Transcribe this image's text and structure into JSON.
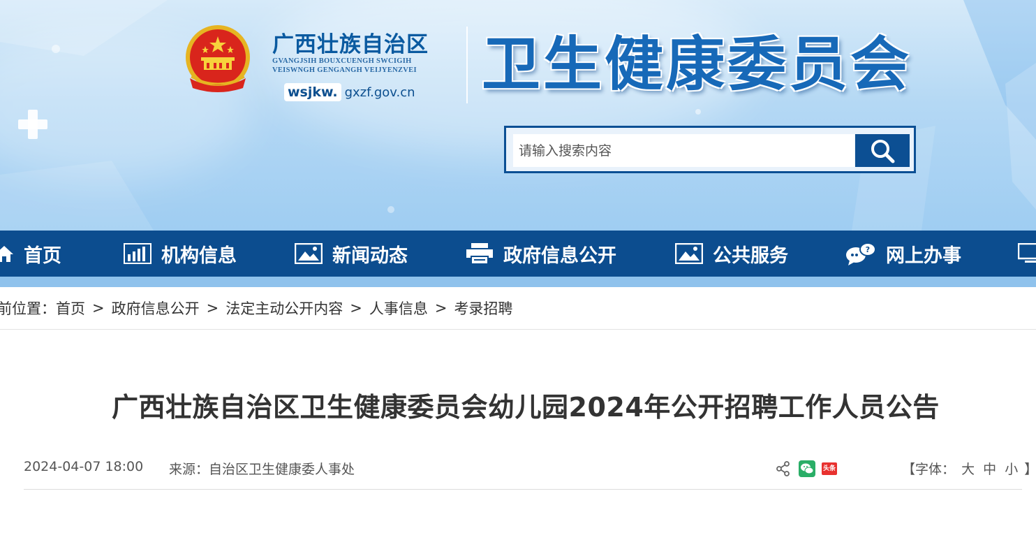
{
  "header": {
    "region_name": "广西壮族自治区",
    "zhuang_line1": "GVANGJSIH BOUXCUENGH SWCIGIH",
    "zhuang_line2": "VEISWNGH GENGANGH VEIJYENZVEI",
    "domain_prefix": "wsjkw.",
    "domain_rest": "gxzf.gov.cn",
    "commission_title": "卫生健康委员会",
    "emblem_icon": "national-emblem-icon"
  },
  "search": {
    "placeholder": "请输入搜索内容",
    "button_icon": "search-icon"
  },
  "nav": {
    "items": [
      {
        "label": "首页",
        "icon": "home-icon"
      },
      {
        "label": "机构信息",
        "icon": "bar-chart-icon"
      },
      {
        "label": "新闻动态",
        "icon": "image-icon"
      },
      {
        "label": "政府信息公开",
        "icon": "printer-icon"
      },
      {
        "label": "公共服务",
        "icon": "image-icon"
      },
      {
        "label": "网上办事",
        "icon": "chat-icon"
      },
      {
        "label": "",
        "icon": "monitor-icon"
      }
    ]
  },
  "breadcrumb": {
    "prefix": "前位置：",
    "items": [
      "首页",
      "政府信息公开",
      "法定主动公开内容",
      "人事信息",
      "考录招聘"
    ],
    "separator": ">"
  },
  "article": {
    "title": "广西壮族自治区卫生健康委员会幼儿园2024年公开招聘工作人员公告",
    "date": "2024-04-07 18:00",
    "source": "来源：自治区卫生健康委人事处",
    "share_icons": [
      "share-icon",
      "wechat-icon",
      "toutiao-icon"
    ],
    "toutiao_text": "头条",
    "font_size": {
      "open": "【字体：",
      "options": [
        "大",
        "中",
        "小"
      ],
      "close": "】"
    }
  },
  "colors": {
    "nav_bg": "#0c4d8f",
    "nav_stripe": "#8fc2ec",
    "title_blue": "#1769b8",
    "text": "#333333"
  }
}
